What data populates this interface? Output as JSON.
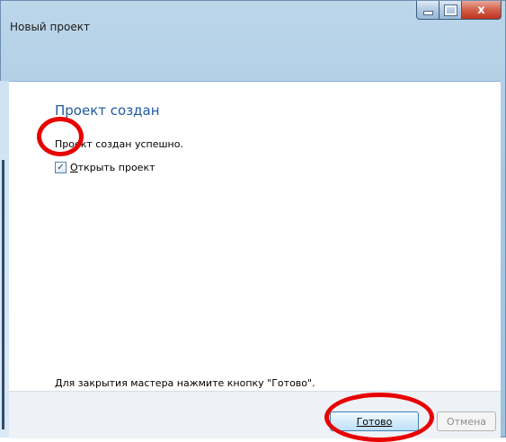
{
  "window": {
    "title": "Новый проект",
    "close_glyph": "x"
  },
  "content": {
    "heading": "Проект создан",
    "message": "Проект создан успешно.",
    "checkbox": {
      "checked": true,
      "label_accel": "О",
      "label_rest": "ткрыть проект"
    },
    "hint": "Для закрытия мастера нажмите кнопку \"Готово\"."
  },
  "buttons": {
    "done_label": "Готово",
    "cancel_label": "Отмена"
  }
}
